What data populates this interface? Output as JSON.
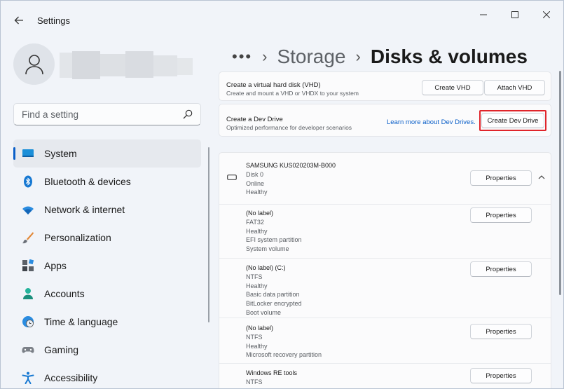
{
  "window": {
    "title": "Settings"
  },
  "sidebar": {
    "search_placeholder": "Find a setting",
    "items": [
      {
        "label": "System",
        "icon": "system-icon",
        "active": true
      },
      {
        "label": "Bluetooth & devices",
        "icon": "bluetooth-icon"
      },
      {
        "label": "Network & internet",
        "icon": "wifi-icon"
      },
      {
        "label": "Personalization",
        "icon": "brush-icon"
      },
      {
        "label": "Apps",
        "icon": "apps-icon"
      },
      {
        "label": "Accounts",
        "icon": "accounts-icon"
      },
      {
        "label": "Time & language",
        "icon": "globe-clock-icon"
      },
      {
        "label": "Gaming",
        "icon": "gamepad-icon"
      },
      {
        "label": "Accessibility",
        "icon": "accessibility-icon"
      }
    ]
  },
  "breadcrumb": {
    "more": "•••",
    "parent": "Storage",
    "current": "Disks & volumes"
  },
  "vhd_card": {
    "title": "Create a virtual hard disk (VHD)",
    "subtitle": "Create and mount a VHD or VHDX to your system",
    "create_label": "Create VHD",
    "attach_label": "Attach VHD"
  },
  "dev_card": {
    "title": "Create a Dev Drive",
    "subtitle": "Optimized performance for developer scenarios",
    "link": "Learn more about Dev Drives.",
    "button_label": "Create Dev Drive"
  },
  "disk": {
    "name": "SAMSUNG KUS020203M-B000",
    "lines": [
      "Disk 0",
      "Online",
      "Healthy"
    ],
    "properties_label": "Properties"
  },
  "volumes": [
    {
      "name": "(No label)",
      "lines": [
        "FAT32",
        "Healthy",
        "EFI system partition",
        "System volume"
      ],
      "properties_label": "Properties"
    },
    {
      "name": "(No label) (C:)",
      "lines": [
        "NTFS",
        "Healthy",
        "Basic data partition",
        "BitLocker encrypted",
        "Boot volume"
      ],
      "properties_label": "Properties"
    },
    {
      "name": "(No label)",
      "lines": [
        "NTFS",
        "Healthy",
        "Microsoft recovery partition"
      ],
      "properties_label": "Properties"
    },
    {
      "name": "Windows RE tools",
      "lines": [
        "NTFS"
      ],
      "properties_label": "Properties"
    }
  ],
  "colors": {
    "accent": "#0a5fc8",
    "highlight_frame": "#e0242a"
  }
}
